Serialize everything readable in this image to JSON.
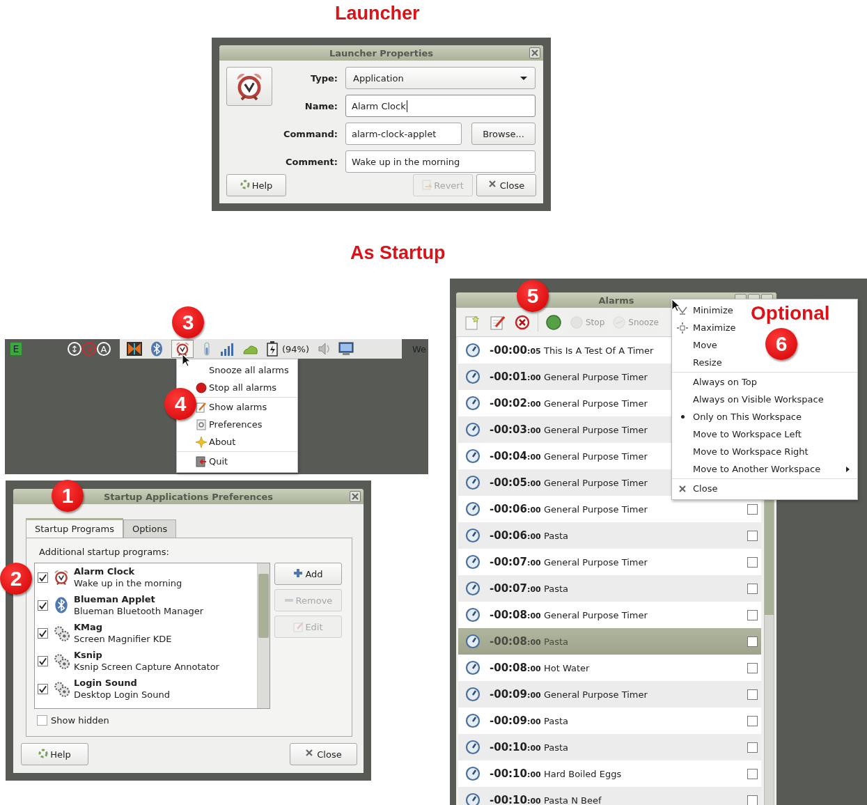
{
  "launcher_heading": "Launcher",
  "launcher": {
    "title": "Launcher Properties",
    "fields": [
      {
        "label": "Type:",
        "kind": "dropdown",
        "value": "Application",
        "focused": false
      },
      {
        "label": "Name:",
        "kind": "text",
        "value": "Alarm Clock",
        "focused": true
      },
      {
        "label": "Command:",
        "kind": "text_browse",
        "value": "alarm-clock-applet",
        "button": "Browse...",
        "focused": false
      },
      {
        "label": "Comment:",
        "kind": "text",
        "value": "Wake up in the morning",
        "focused": false
      }
    ],
    "buttons": [
      {
        "label": "Help",
        "disabled": false
      },
      {
        "label": "Revert",
        "disabled": true
      },
      {
        "label": "Close",
        "disabled": false
      }
    ]
  },
  "startup_heading": "As Startup",
  "taskbar": {
    "launcher": "E",
    "indicators": [
      {
        "text": "↕",
        "color": "#ffffff"
      },
      {
        "text": "9",
        "color": "#d42a2a"
      },
      {
        "text": "A",
        "color": "#ffffff"
      }
    ],
    "alarm_icon_active": true,
    "battery": "(94%)",
    "clock": "We"
  },
  "tray_menu": {
    "items": [
      {
        "label": "Snooze all alarms",
        "divider_above": false
      },
      {
        "label": "Stop all alarms",
        "divider_above": false
      },
      {
        "label": "Show alarms",
        "divider_above": true
      },
      {
        "label": "Preferences",
        "divider_above": false
      },
      {
        "label": "About",
        "divider_above": false
      },
      {
        "label": "Quit",
        "divider_above": true
      }
    ]
  },
  "startup_dialog": {
    "title": "Startup Applications Preferences",
    "tabs": [
      {
        "label": "Startup Programs",
        "selected": true
      },
      {
        "label": "Options",
        "selected": false
      }
    ],
    "list_label": "Additional startup programs:",
    "programs": [
      {
        "name": "Alarm Clock",
        "description": "Wake up in the morning",
        "checked": true
      },
      {
        "name": "Blueman Applet",
        "description": "Blueman Bluetooth Manager",
        "checked": true
      },
      {
        "name": "KMag",
        "description": "Screen Magnifier KDE",
        "checked": true
      },
      {
        "name": "Ksnip",
        "description": "Ksnip Screen Capture Annotator",
        "checked": true
      },
      {
        "name": "Login Sound",
        "description": "Desktop Login Sound",
        "checked": true
      }
    ],
    "side_buttons": [
      {
        "label": "Add",
        "disabled": false
      },
      {
        "label": "Remove",
        "disabled": true
      },
      {
        "label": "Edit",
        "disabled": true
      }
    ],
    "show_hidden": {
      "label": "Show hidden",
      "checked": false
    },
    "buttons": [
      {
        "label": "Help"
      },
      {
        "label": "Close"
      }
    ]
  },
  "alarms_window": {
    "title": "Alarms",
    "toolbar": [
      {
        "label": "Stop",
        "disabled": true
      },
      {
        "label": "Snooze",
        "disabled": true
      }
    ],
    "alarms": [
      {
        "time": "-00:00",
        "seconds": ":05",
        "name": "This Is A Test Of A Timer",
        "selected": false
      },
      {
        "time": "-00:01",
        "seconds": ":00",
        "name": "General Purpose Timer",
        "selected": false
      },
      {
        "time": "-00:02",
        "seconds": ":00",
        "name": "General Purpose Timer",
        "selected": false
      },
      {
        "time": "-00:03",
        "seconds": ":00",
        "name": "General Purpose Timer",
        "selected": false
      },
      {
        "time": "-00:04",
        "seconds": ":00",
        "name": "General Purpose Timer",
        "selected": false
      },
      {
        "time": "-00:05",
        "seconds": ":00",
        "name": "General Purpose Timer",
        "selected": false
      },
      {
        "time": "-00:06",
        "seconds": ":00",
        "name": "General Purpose Timer",
        "selected": false,
        "checked": false
      },
      {
        "time": "-00:06",
        "seconds": ":00",
        "name": "Pasta",
        "selected": false,
        "checked": false
      },
      {
        "time": "-00:07",
        "seconds": ":00",
        "name": "General Purpose Timer",
        "selected": false,
        "checked": false
      },
      {
        "time": "-00:07",
        "seconds": ":00",
        "name": "Pasta",
        "selected": false,
        "checked": false
      },
      {
        "time": "-00:08",
        "seconds": ":00",
        "name": "General Purpose Timer",
        "selected": false,
        "checked": false
      },
      {
        "time": "-00:08",
        "seconds": ":00",
        "name": "Pasta",
        "selected": true,
        "checked": false
      },
      {
        "time": "-00:08",
        "seconds": ":00",
        "name": "Hot Water",
        "selected": false,
        "checked": false
      },
      {
        "time": "-00:09",
        "seconds": ":00",
        "name": "General Purpose Timer",
        "selected": false,
        "checked": false
      },
      {
        "time": "-00:09",
        "seconds": ":00",
        "name": "Pasta",
        "selected": false,
        "checked": false
      },
      {
        "time": "-00:10",
        "seconds": ":00",
        "name": "Pasta",
        "selected": false,
        "checked": false
      },
      {
        "time": "-00:10",
        "seconds": ":00",
        "name": "Hard Boiled Eggs",
        "selected": false,
        "checked": false
      },
      {
        "time": "-00:10",
        "seconds": ":00",
        "name": "Pasta N Beef",
        "selected": false,
        "checked": false
      }
    ]
  },
  "window_menu": {
    "note": "Optional",
    "items": [
      {
        "label": "Minimize",
        "divider_above": false,
        "selected": false,
        "submenu": false
      },
      {
        "label": "Maximize",
        "divider_above": false,
        "selected": false,
        "submenu": false
      },
      {
        "label": "Move",
        "divider_above": false,
        "selected": false,
        "submenu": false
      },
      {
        "label": "Resize",
        "divider_above": false,
        "selected": false,
        "submenu": false
      },
      {
        "label": "Always on Top",
        "divider_above": true,
        "selected": false,
        "submenu": false
      },
      {
        "label": "Always on Visible Workspace",
        "divider_above": false,
        "selected": false,
        "submenu": false
      },
      {
        "label": "Only on This Workspace",
        "divider_above": false,
        "selected": true,
        "submenu": false
      },
      {
        "label": "Move to Workspace Left",
        "divider_above": false,
        "selected": false,
        "submenu": false
      },
      {
        "label": "Move to Workspace Right",
        "divider_above": false,
        "selected": false,
        "submenu": false
      },
      {
        "label": "Move to Another Workspace",
        "divider_above": false,
        "selected": false,
        "submenu": true
      },
      {
        "label": "Close",
        "divider_above": true,
        "selected": false,
        "submenu": false
      }
    ]
  },
  "callouts": [
    "1",
    "2",
    "3",
    "4",
    "5",
    "6"
  ]
}
